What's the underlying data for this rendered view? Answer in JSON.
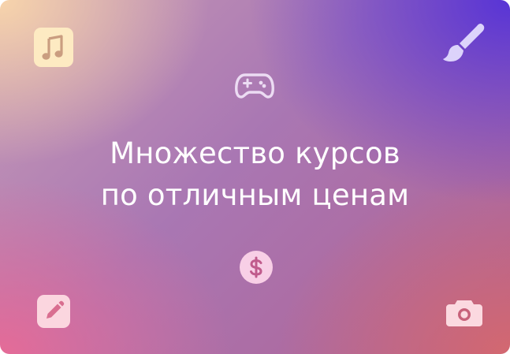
{
  "banner": {
    "headline_line1": "Множество курсов",
    "headline_line2": "по отличным ценам"
  },
  "icons": {
    "top_left": "music-note-icon",
    "top_right": "paintbrush-icon",
    "top_center": "gamepad-icon",
    "bottom_center": "dollar-coin-icon",
    "bottom_left": "pencil-icon",
    "bottom_right": "camera-icon"
  },
  "colors": {
    "gradient_top_left": "#f7d4ab",
    "gradient_top_right": "#5834d6",
    "gradient_bottom_left": "#e86a96",
    "gradient_bottom_right": "#d5686e",
    "headline_text": "#ffffff",
    "music_icon_bg": "#fdeac2",
    "music_icon_fg": "#ca9d80",
    "brush_icon": "#dcd3fb",
    "gamepad_icon": "#ecdcf3",
    "dollar_icon_bg": "#f8cfe6",
    "dollar_icon_fg": "#c05b8c",
    "pencil_icon_bg": "#fbd6df",
    "pencil_icon_fg": "#d96e90",
    "camera_icon": "#fbd9e0"
  }
}
